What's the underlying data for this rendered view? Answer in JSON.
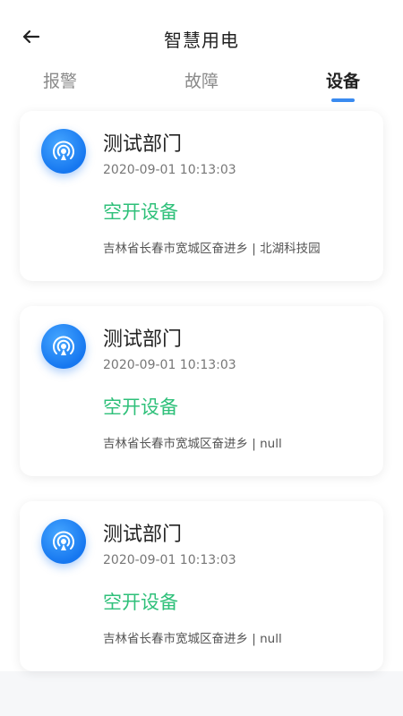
{
  "header": {
    "title": "智慧用电"
  },
  "tabs": [
    {
      "label": "报警"
    },
    {
      "label": "故障"
    },
    {
      "label": "设备"
    }
  ],
  "devices": [
    {
      "department": "测试部门",
      "time": "2020-09-01 10:13:03",
      "status": "空开设备",
      "address": "吉林省长春市宽城区奋进乡 | 北湖科技园"
    },
    {
      "department": "测试部门",
      "time": "2020-09-01 10:13:03",
      "status": "空开设备",
      "address": "吉林省长春市宽城区奋进乡 | null"
    },
    {
      "department": "测试部门",
      "time": "2020-09-01 10:13:03",
      "status": "空开设备",
      "address": "吉林省长春市宽城区奋进乡 | null"
    }
  ],
  "colors": {
    "accent": "#3a8bf0",
    "status_green": "#2fc07a"
  },
  "icons": {
    "back": "arrow-left-icon",
    "device": "broadcast-icon"
  }
}
